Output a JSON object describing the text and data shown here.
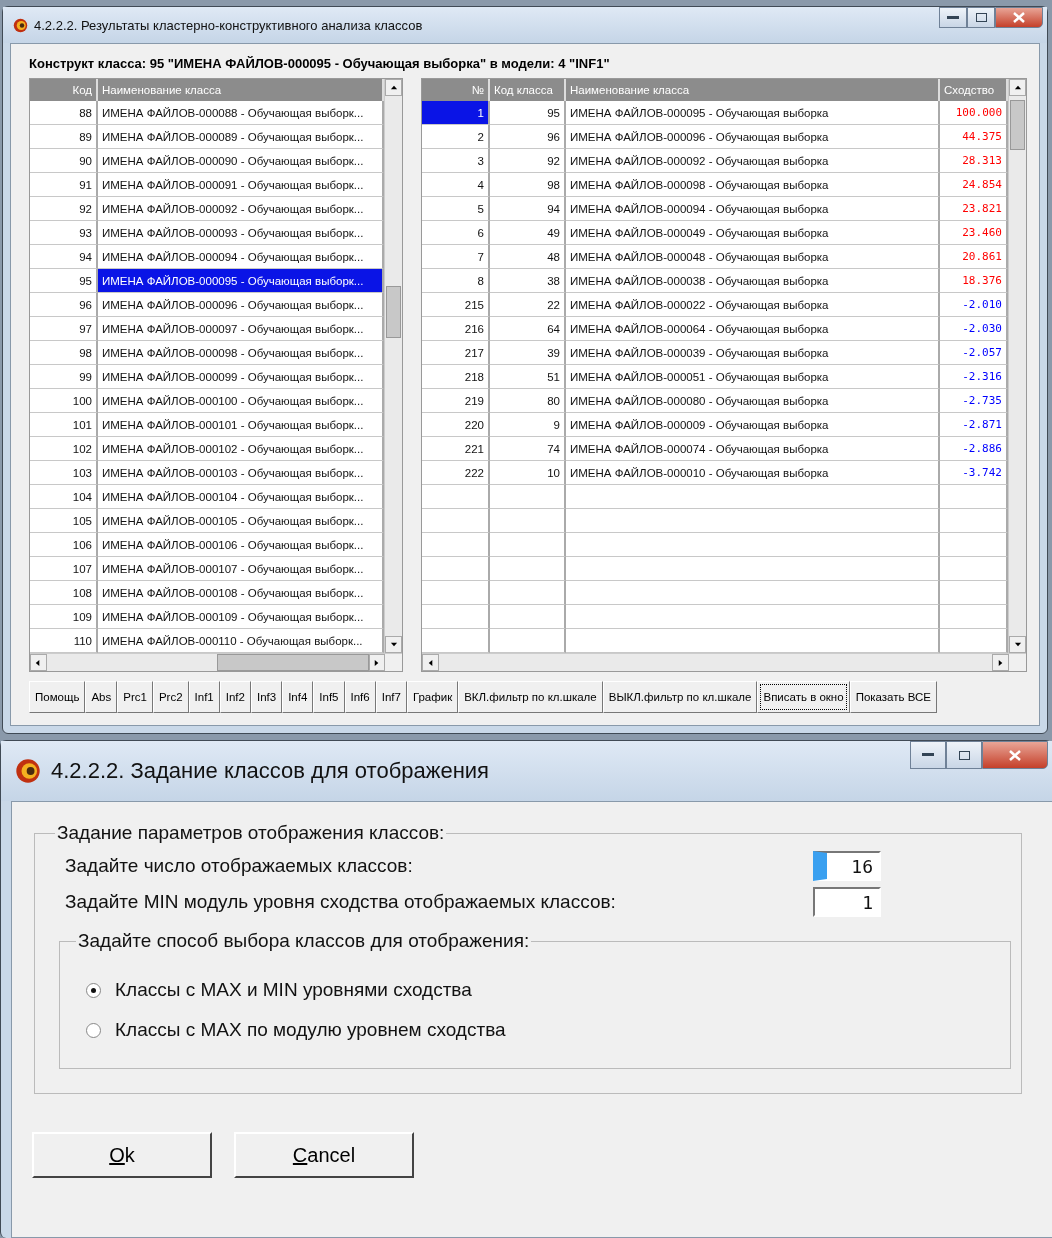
{
  "results_window": {
    "title": "4.2.2.2. Результаты кластерно-конструктивного анализа классов",
    "heading": "Конструкт класса: 95 \"ИМЕНА ФАЙЛОВ-000095 - Обучающая выборка\" в модели: 4 \"INF1\"",
    "class_table": {
      "columns": [
        "Код",
        "Наименование класса"
      ],
      "rows": [
        {
          "code": "88",
          "name": "ИМЕНА ФАЙЛОВ-000088 - Обучающая выборк...",
          "selected": false
        },
        {
          "code": "89",
          "name": "ИМЕНА ФАЙЛОВ-000089 - Обучающая выборк...",
          "selected": false
        },
        {
          "code": "90",
          "name": "ИМЕНА ФАЙЛОВ-000090 - Обучающая выборк...",
          "selected": false
        },
        {
          "code": "91",
          "name": "ИМЕНА ФАЙЛОВ-000091 - Обучающая выборк...",
          "selected": false
        },
        {
          "code": "92",
          "name": "ИМЕНА ФАЙЛОВ-000092 - Обучающая выборк...",
          "selected": false
        },
        {
          "code": "93",
          "name": "ИМЕНА ФАЙЛОВ-000093 - Обучающая выборк...",
          "selected": false
        },
        {
          "code": "94",
          "name": "ИМЕНА ФАЙЛОВ-000094 - Обучающая выборк...",
          "selected": false
        },
        {
          "code": "95",
          "name": "ИМЕНА ФАЙЛОВ-000095 - Обучающая выборк...",
          "selected": true
        },
        {
          "code": "96",
          "name": "ИМЕНА ФАЙЛОВ-000096 - Обучающая выборк...",
          "selected": false
        },
        {
          "code": "97",
          "name": "ИМЕНА ФАЙЛОВ-000097 - Обучающая выборк...",
          "selected": false
        },
        {
          "code": "98",
          "name": "ИМЕНА ФАЙЛОВ-000098 - Обучающая выборк...",
          "selected": false
        },
        {
          "code": "99",
          "name": "ИМЕНА ФАЙЛОВ-000099 - Обучающая выборк...",
          "selected": false
        },
        {
          "code": "100",
          "name": "ИМЕНА ФАЙЛОВ-000100 - Обучающая выборк...",
          "selected": false
        },
        {
          "code": "101",
          "name": "ИМЕНА ФАЙЛОВ-000101 - Обучающая выборк...",
          "selected": false
        },
        {
          "code": "102",
          "name": "ИМЕНА ФАЙЛОВ-000102 - Обучающая выборк...",
          "selected": false
        },
        {
          "code": "103",
          "name": "ИМЕНА ФАЙЛОВ-000103 - Обучающая выборк...",
          "selected": false
        },
        {
          "code": "104",
          "name": "ИМЕНА ФАЙЛОВ-000104 - Обучающая выборк...",
          "selected": false
        },
        {
          "code": "105",
          "name": "ИМЕНА ФАЙЛОВ-000105 - Обучающая выборк...",
          "selected": false
        },
        {
          "code": "106",
          "name": "ИМЕНА ФАЙЛОВ-000106 - Обучающая выборк...",
          "selected": false
        },
        {
          "code": "107",
          "name": "ИМЕНА ФАЙЛОВ-000107 - Обучающая выборк...",
          "selected": false
        },
        {
          "code": "108",
          "name": "ИМЕНА ФАЙЛОВ-000108 - Обучающая выборк...",
          "selected": false
        },
        {
          "code": "109",
          "name": "ИМЕНА ФАЙЛОВ-000109 - Обучающая выборк...",
          "selected": false
        },
        {
          "code": "110",
          "name": "ИМЕНА ФАЙЛОВ-000110 - Обучающая выборк...",
          "selected": false
        }
      ]
    },
    "similarity_table": {
      "columns": [
        "№",
        "Код класса",
        "Наименование класса",
        "Сходство"
      ],
      "rows": [
        {
          "index": "1",
          "code": "95",
          "name": "ИМЕНА ФАЙЛОВ-000095 - Обучающая выборка",
          "similarity": "100.000",
          "color": "#ff0000",
          "selected": true
        },
        {
          "index": "2",
          "code": "96",
          "name": "ИМЕНА ФАЙЛОВ-000096 - Обучающая выборка",
          "similarity": "44.375",
          "color": "#ff0000",
          "selected": false
        },
        {
          "index": "3",
          "code": "92",
          "name": "ИМЕНА ФАЙЛОВ-000092 - Обучающая выборка",
          "similarity": "28.313",
          "color": "#ff0000",
          "selected": false
        },
        {
          "index": "4",
          "code": "98",
          "name": "ИМЕНА ФАЙЛОВ-000098 - Обучающая выборка",
          "similarity": "24.854",
          "color": "#ff0000",
          "selected": false
        },
        {
          "index": "5",
          "code": "94",
          "name": "ИМЕНА ФАЙЛОВ-000094 - Обучающая выборка",
          "similarity": "23.821",
          "color": "#ff0000",
          "selected": false
        },
        {
          "index": "6",
          "code": "49",
          "name": "ИМЕНА ФАЙЛОВ-000049 - Обучающая выборка",
          "similarity": "23.460",
          "color": "#ff0000",
          "selected": false
        },
        {
          "index": "7",
          "code": "48",
          "name": "ИМЕНА ФАЙЛОВ-000048 - Обучающая выборка",
          "similarity": "20.861",
          "color": "#ff0000",
          "selected": false
        },
        {
          "index": "8",
          "code": "38",
          "name": "ИМЕНА ФАЙЛОВ-000038 - Обучающая выборка",
          "similarity": "18.376",
          "color": "#ff0000",
          "selected": false
        },
        {
          "index": "215",
          "code": "22",
          "name": "ИМЕНА ФАЙЛОВ-000022 - Обучающая выборка",
          "similarity": "-2.010",
          "color": "#0000ff",
          "selected": false
        },
        {
          "index": "216",
          "code": "64",
          "name": "ИМЕНА ФАЙЛОВ-000064 - Обучающая выборка",
          "similarity": "-2.030",
          "color": "#0000ff",
          "selected": false
        },
        {
          "index": "217",
          "code": "39",
          "name": "ИМЕНА ФАЙЛОВ-000039 - Обучающая выборка",
          "similarity": "-2.057",
          "color": "#0000ff",
          "selected": false
        },
        {
          "index": "218",
          "code": "51",
          "name": "ИМЕНА ФАЙЛОВ-000051 - Обучающая выборка",
          "similarity": "-2.316",
          "color": "#0000ff",
          "selected": false
        },
        {
          "index": "219",
          "code": "80",
          "name": "ИМЕНА ФАЙЛОВ-000080 - Обучающая выборка",
          "similarity": "-2.735",
          "color": "#0000ff",
          "selected": false
        },
        {
          "index": "220",
          "code": "9",
          "name": "ИМЕНА ФАЙЛОВ-000009 - Обучающая выборка",
          "similarity": "-2.871",
          "color": "#0000ff",
          "selected": false
        },
        {
          "index": "221",
          "code": "74",
          "name": "ИМЕНА ФАЙЛОВ-000074 - Обучающая выборка",
          "similarity": "-2.886",
          "color": "#0000ff",
          "selected": false
        },
        {
          "index": "222",
          "code": "10",
          "name": "ИМЕНА ФАЙЛОВ-000010 - Обучающая выборка",
          "similarity": "-3.742",
          "color": "#0000ff",
          "selected": false
        }
      ]
    },
    "buttons": [
      {
        "label": "Помощь",
        "focused": false
      },
      {
        "label": "Abs",
        "focused": false
      },
      {
        "label": "Prc1",
        "focused": false
      },
      {
        "label": "Prc2",
        "focused": false
      },
      {
        "label": "Inf1",
        "focused": false
      },
      {
        "label": "Inf2",
        "focused": false
      },
      {
        "label": "Inf3",
        "focused": false
      },
      {
        "label": "Inf4",
        "focused": false
      },
      {
        "label": "Inf5",
        "focused": false
      },
      {
        "label": "Inf6",
        "focused": false
      },
      {
        "label": "Inf7",
        "focused": false
      },
      {
        "label": "График",
        "focused": false
      },
      {
        "label": "ВКЛ.фильтр по кл.шкале",
        "focused": false
      },
      {
        "label": "ВЫКЛ.фильтр по кл.шкале",
        "focused": false
      },
      {
        "label": "Вписать в окно",
        "focused": true
      },
      {
        "label": "Показать ВСЕ",
        "focused": false
      }
    ]
  },
  "dialog": {
    "title": "4.2.2.2. Задание классов для отображения",
    "group": {
      "label": "Задание параметров отображения классов:",
      "fields": [
        {
          "label": "Задайте число отображаемых классов:",
          "value": "16",
          "focused": true
        },
        {
          "label": "Задайте MIN модуль уровня сходства отображаемых классов:",
          "value": "1",
          "focused": false
        }
      ],
      "mode_group": {
        "label": "Задайте способ выбора классов для отображения:",
        "options": [
          {
            "label": "Классы с MAX и MIN уровнями сходства",
            "selected": true
          },
          {
            "label": "Классы с MAX по модулю уровнем сходства",
            "selected": false
          }
        ]
      }
    },
    "buttons": [
      {
        "label": "Ok"
      },
      {
        "label": "Cancel"
      }
    ]
  }
}
